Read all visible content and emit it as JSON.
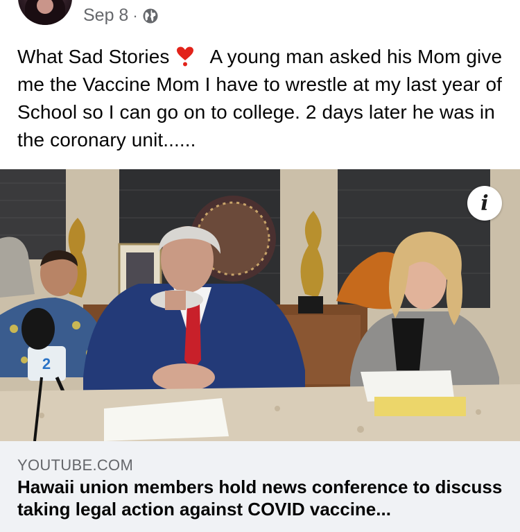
{
  "post": {
    "date": "Sep 8",
    "separator": "·",
    "privacy_icon": "globe-icon",
    "text_before_emoji": "What Sad Stories",
    "emoji": "heavy-heart-exclamation",
    "text_after_emoji": "A young man asked his Mom give me the Vaccine Mom I have to wrestle at my last year of School so I can go on to college.  2 days later he was in the coronary unit......"
  },
  "media": {
    "info_label": "i",
    "mic_logo_text": "2"
  },
  "link": {
    "domain": "YOUTUBE.COM",
    "title": "Hawaii union members hold news conference to discuss taking legal action against COVID vaccine..."
  },
  "colors": {
    "meta_gray": "#65676b",
    "preview_bg": "#f0f2f5",
    "text": "#050505"
  }
}
